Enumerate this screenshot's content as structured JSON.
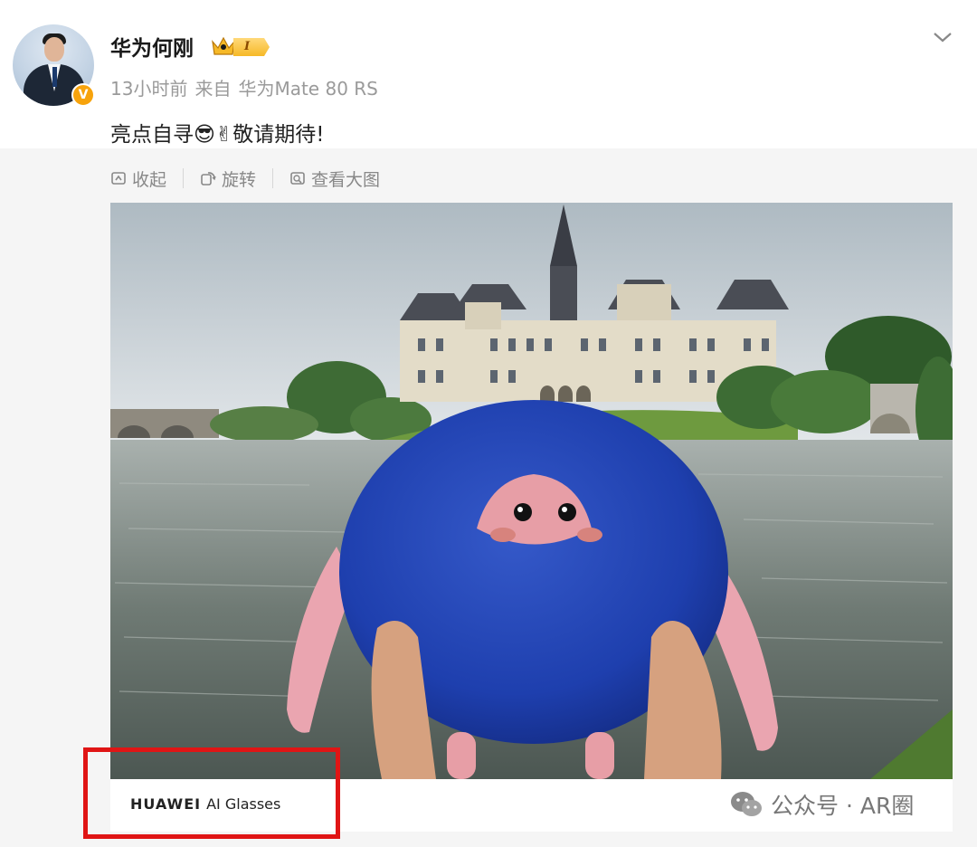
{
  "post": {
    "username": "华为何刚",
    "level_badge": "I",
    "time": "13小时前",
    "source_prefix": "来自",
    "source_device": "华为Mate 80 RS",
    "text_part1": "亮点自寻",
    "emoji1": "😎",
    "emoji2": "✌",
    "text_part2": "敬请期待!"
  },
  "icons": {
    "verified": "V",
    "more": "chevron-down-icon"
  },
  "media_toolbar": {
    "collapse_label": "收起",
    "rotate_label": "旋转",
    "view_large_label": "查看大图"
  },
  "photo_caption": {
    "brand": "HUAWEI",
    "product": "AI Glasses"
  },
  "watermark": {
    "text": "公众号 · AR圈"
  },
  "colors": {
    "highlight_box": "#e01515",
    "verified_badge": "#f7a30c",
    "plush_blue": "#1e3fae",
    "plush_pink": "#eaa5b0"
  }
}
